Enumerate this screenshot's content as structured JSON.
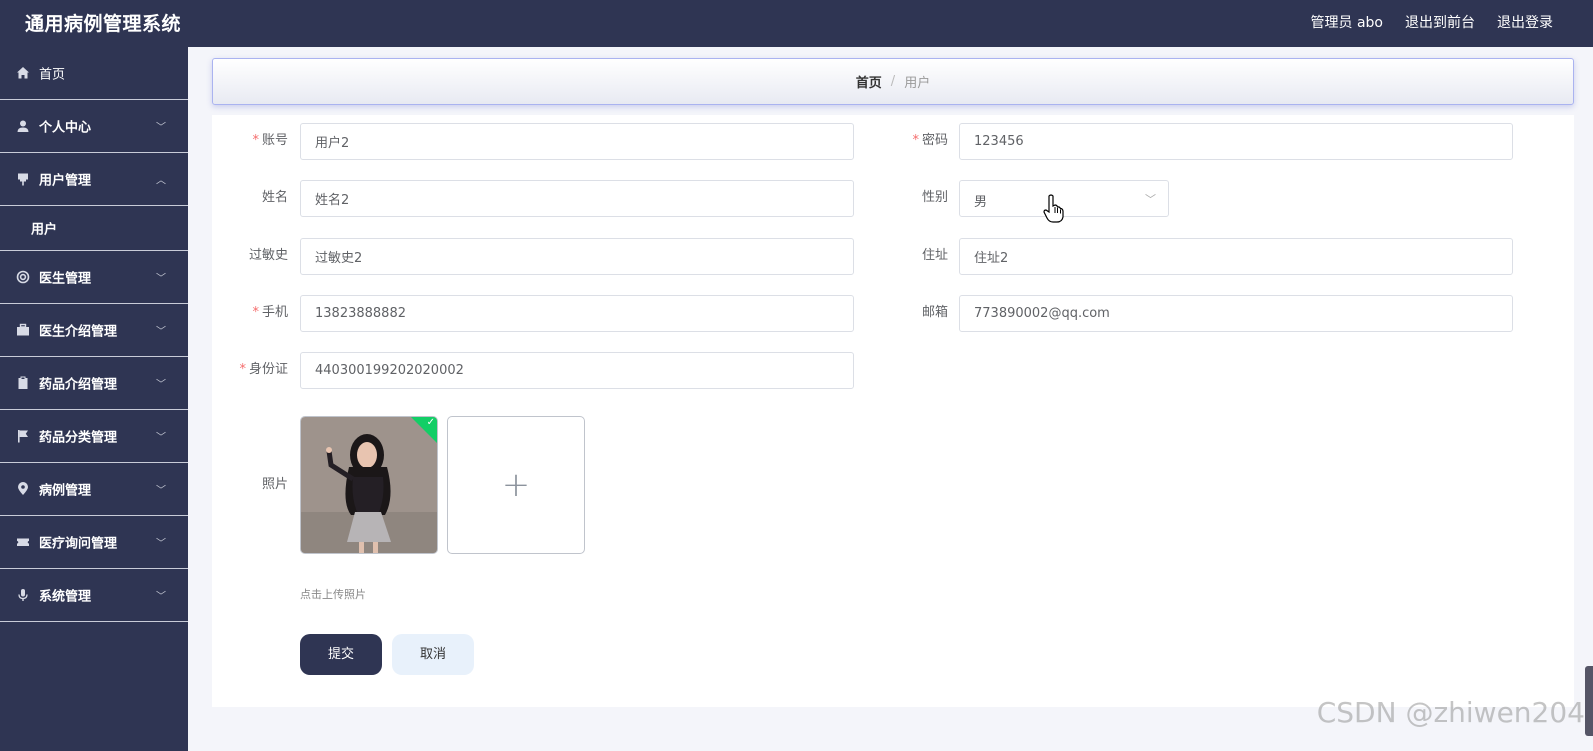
{
  "header": {
    "title": "通用病例管理系统",
    "admin_label": "管理员 abo",
    "to_front_label": "退出到前台",
    "logout_label": "退出登录"
  },
  "sidebar": {
    "items": [
      {
        "label": "首页",
        "icon": "home-icon"
      },
      {
        "label": "个人中心",
        "icon": "user-icon"
      },
      {
        "label": "用户管理",
        "icon": "pin-icon"
      },
      {
        "label": "医生管理",
        "icon": "lifebuoy-icon"
      },
      {
        "label": "医生介绍管理",
        "icon": "briefcase-icon"
      },
      {
        "label": "药品介绍管理",
        "icon": "clipboard-icon"
      },
      {
        "label": "药品分类管理",
        "icon": "flag-icon"
      },
      {
        "label": "病例管理",
        "icon": "location-icon"
      },
      {
        "label": "医疗询问管理",
        "icon": "ticket-icon"
      },
      {
        "label": "系统管理",
        "icon": "microphone-icon"
      }
    ],
    "submenu_user": "用户"
  },
  "breadcrumb": {
    "home": "首页",
    "separator": "/",
    "current": "用户"
  },
  "form": {
    "account": {
      "label": "账号",
      "value": "用户2"
    },
    "password": {
      "label": "密码",
      "value": "123456"
    },
    "name": {
      "label": "姓名",
      "value": "姓名2"
    },
    "gender": {
      "label": "性别",
      "value": "男"
    },
    "allergy": {
      "label": "过敏史",
      "value": "过敏史2"
    },
    "address": {
      "label": "住址",
      "value": "住址2"
    },
    "phone": {
      "label": "手机",
      "value": "13823888882"
    },
    "email": {
      "label": "邮箱",
      "value": "773890002@qq.com"
    },
    "id_card": {
      "label": "身份证",
      "value": "440300199202020002"
    },
    "photo": {
      "label": "照片",
      "tip": "点击上传照片"
    },
    "submit_label": "提交",
    "cancel_label": "取消"
  },
  "watermark": "CSDN @zhiwen204",
  "colors": {
    "header_bg": "#2f3553",
    "required_mark": "#f56c6c",
    "success_badge": "#13ce66",
    "cancel_bg": "#e8f1fb"
  }
}
